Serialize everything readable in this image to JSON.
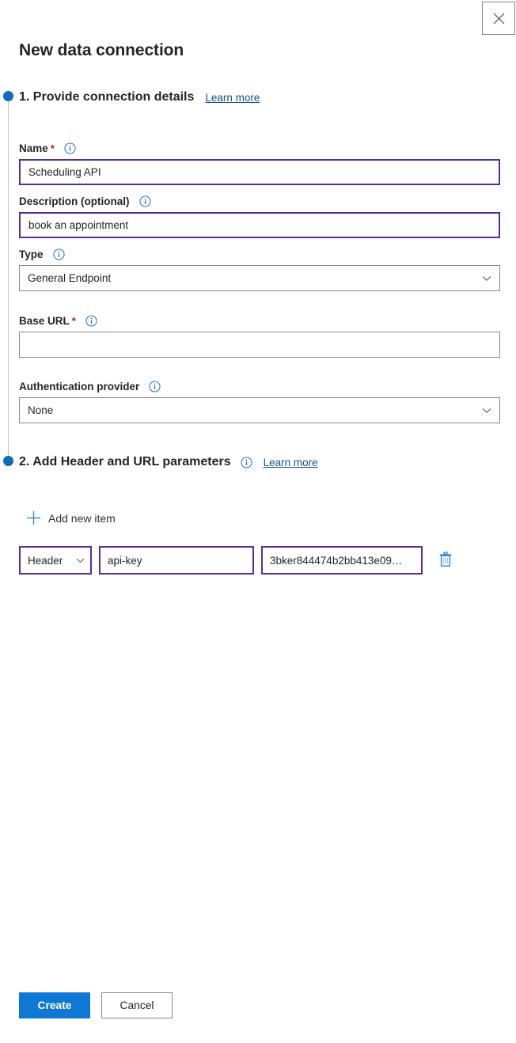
{
  "window": {
    "title": "New data connection",
    "close_icon": "close-icon"
  },
  "steps": [
    {
      "id": "step-1",
      "title": "1. Provide connection details",
      "learn_more": "Learn more",
      "has_info_icon": false
    },
    {
      "id": "step-2",
      "title": "2. Add Header and URL parameters",
      "learn_more": "Learn more",
      "has_info_icon": true
    }
  ],
  "form": {
    "name": {
      "label": "Name",
      "required_marker": "*",
      "value": "Scheduling API",
      "placeholder": "",
      "info_icon": "info-icon"
    },
    "description": {
      "label": "Description (optional)",
      "value": "book an appointment",
      "placeholder": "",
      "info_icon": "info-icon"
    },
    "type": {
      "label": "Type",
      "value": "General Endpoint",
      "info_icon": "info-icon",
      "chevron_icon": "chevron-down-icon"
    },
    "base_url": {
      "label": "Base URL",
      "required_marker": "*",
      "value": "",
      "placeholder": "",
      "info_icon": "info-icon"
    },
    "auth_provider": {
      "label": "Authentication provider",
      "value": "None",
      "info_icon": "info-icon",
      "chevron_icon": "chevron-down-icon"
    }
  },
  "parameters": {
    "add_new_label": "Add new item",
    "add_icon": "plus-icon",
    "rows": [
      {
        "type": "Header",
        "key": "api-key",
        "value": "3bker844474b2bb413e09…",
        "delete_icon": "trash-icon",
        "chevron_icon": "chevron-down-icon"
      }
    ]
  },
  "footer": {
    "create_label": "Create",
    "cancel_label": "Cancel"
  },
  "colors": {
    "accent_blue": "#0f78d4",
    "step_dot": "#0f6cbd",
    "link": "#0f548c",
    "focused_border": "#5c2d91",
    "default_border": "#8a8886",
    "required_star": "#a4262c"
  }
}
